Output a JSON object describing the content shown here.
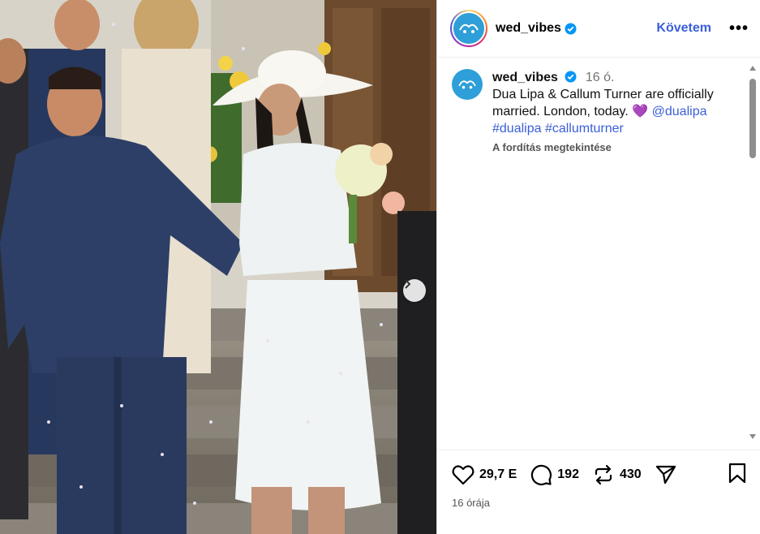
{
  "post": {
    "username": "wed_vibes",
    "follow_label": "Követem",
    "more_label": "•••"
  },
  "caption": {
    "username": "wed_vibes",
    "time": "16 ó.",
    "text": "Dua Lipa & Callum Turner are officially married. London, today.",
    "emoji": "💜",
    "mention": "@dualipa",
    "hashtags": [
      "#dualipa",
      "#callumturner"
    ],
    "translate_label": "A fordítás megtekintése"
  },
  "actions": {
    "likes": "29,7 E",
    "comments": "192",
    "reposts": "430",
    "time_ago": "16 órája"
  },
  "colors": {
    "accent": "#3b5fd8",
    "verified": "#0095f6",
    "avatar_bg": "#2e9fd8"
  },
  "icons": [
    "verified-badge-icon",
    "more-options-icon",
    "heart-icon",
    "comment-icon",
    "repost-icon",
    "share-icon",
    "bookmark-icon",
    "chevron-right-icon"
  ]
}
